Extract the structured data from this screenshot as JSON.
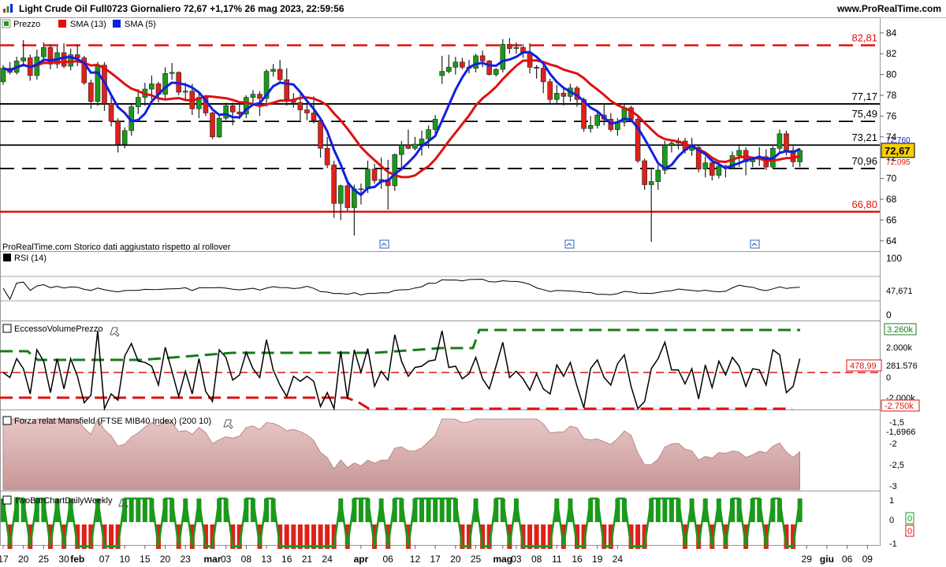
{
  "header": {
    "title": "Light Crude Oil Full0723 Giornaliero 72,67 +1,17% 26 mag 2023, 22:59:56",
    "site": "www.ProRealTime.com"
  },
  "colors": {
    "up": "#1a9a1a",
    "down": "#e0201a",
    "sma13": "#e01010",
    "sma5": "#1020e0",
    "green_dash": "#1a7a1a",
    "mansfield_fill": "#d9b3b3"
  },
  "price_panel": {
    "labels": [
      "Prezzo",
      "SMA (13)",
      "SMA (5)"
    ],
    "note": "ProRealTime.com  Storico dati aggiustato rispetto al rollover",
    "y_ticks": [
      "84",
      "82",
      "80",
      "78",
      "76",
      "74",
      "72",
      "70",
      "68",
      "66",
      "64"
    ],
    "levels": [
      {
        "value": 82.81,
        "label": "82,81",
        "style": "red-dash"
      },
      {
        "value": 77.17,
        "label": "77,17",
        "style": "black-solid"
      },
      {
        "value": 75.49,
        "label": "75,49",
        "style": "black-dash"
      },
      {
        "value": 73.21,
        "label": "73,21",
        "style": "black-solid"
      },
      {
        "value": 70.96,
        "label": "70,96",
        "style": "black-dash"
      },
      {
        "value": 66.8,
        "label": "66,80",
        "style": "red-solid"
      }
    ],
    "last_price": "72,67",
    "sma5_value": "72,760",
    "sma13_value": "72,095"
  },
  "rsi_panel": {
    "label": "RSI (14)",
    "y_ticks": [
      "100",
      "0"
    ],
    "value": "47,671"
  },
  "evp_panel": {
    "label": "EccessoVolumePrezzo",
    "y_ticks": [
      "2.000k",
      "0",
      "-2.000k"
    ],
    "upper": "3.260k",
    "lower": "-2.750k",
    "red_level": "478,99",
    "value": "281.576"
  },
  "mansfield_panel": {
    "label": "Forza relat Mansfield (FTSE MIB40 Index) (200 10)",
    "y_ticks": [
      "-1,5",
      "-2",
      "-2,5",
      "-3"
    ],
    "value": "-1,6966"
  },
  "tbc_panel": {
    "label": "TwoBarChartDailyWeekly",
    "y_ticks": [
      "1",
      "0",
      "-1"
    ],
    "value_top": "0",
    "value_bottom": "0"
  },
  "x_axis": {
    "labels": [
      "17",
      "20",
      "25",
      "30",
      "feb",
      "07",
      "10",
      "15",
      "20",
      "23",
      "mar",
      "03",
      "08",
      "13",
      "16",
      "21",
      "24",
      "apr",
      "06",
      "12",
      "17",
      "20",
      "25",
      "mag",
      "03",
      "08",
      "11",
      "16",
      "19",
      "24",
      "29",
      "giu",
      "06",
      "09"
    ]
  },
  "chart_data": {
    "type": "candlestick",
    "title": "Light Crude Oil Full0723 Giornaliero",
    "x_start": "2023-01-17",
    "x_end": "2023-05-26",
    "ylim": [
      63,
      85.5
    ],
    "ohlc": [
      [
        79.3,
        80.9,
        79.0,
        80.6
      ],
      [
        80.6,
        81.2,
        80.0,
        80.2
      ],
      [
        80.2,
        81.7,
        80.0,
        81.3
      ],
      [
        81.3,
        83.3,
        81.0,
        81.6
      ],
      [
        81.6,
        81.9,
        79.4,
        79.9
      ],
      [
        79.9,
        82.4,
        79.5,
        81.7
      ],
      [
        81.7,
        83.1,
        81.0,
        82.6
      ],
      [
        82.6,
        82.9,
        80.5,
        81.0
      ],
      [
        81.0,
        82.7,
        80.6,
        82.1
      ],
      [
        82.1,
        83.0,
        80.6,
        80.8
      ],
      [
        80.8,
        82.5,
        80.4,
        81.9
      ],
      [
        81.9,
        82.9,
        80.8,
        81.6
      ],
      [
        81.6,
        81.8,
        79.0,
        79.2
      ],
      [
        79.2,
        79.5,
        76.7,
        77.4
      ],
      [
        77.4,
        81.2,
        77.0,
        80.9
      ],
      [
        80.9,
        81.2,
        76.5,
        77.2
      ],
      [
        77.2,
        77.9,
        75.0,
        75.5
      ],
      [
        75.5,
        75.8,
        72.5,
        73.3
      ],
      [
        73.3,
        74.9,
        72.9,
        74.6
      ],
      [
        74.6,
        77.1,
        74.1,
        76.9
      ],
      [
        76.9,
        78.6,
        76.2,
        77.8
      ],
      [
        77.8,
        79.2,
        77.0,
        78.6
      ],
      [
        78.6,
        79.9,
        77.6,
        79.1
      ],
      [
        79.1,
        79.3,
        77.3,
        78.1
      ],
      [
        78.1,
        80.7,
        77.7,
        80.1
      ],
      [
        80.1,
        81.1,
        79.5,
        80.2
      ],
      [
        80.2,
        80.3,
        78.0,
        78.3
      ],
      [
        78.3,
        79.2,
        77.6,
        78.4
      ],
      [
        78.4,
        79.1,
        76.1,
        76.7
      ],
      [
        76.7,
        78.2,
        75.8,
        77.8
      ],
      [
        77.8,
        78.0,
        76.0,
        76.3
      ],
      [
        76.3,
        76.4,
        73.8,
        74.0
      ],
      [
        74.0,
        76.2,
        73.9,
        75.8
      ],
      [
        75.8,
        77.3,
        75.6,
        77.0
      ],
      [
        77.0,
        77.3,
        75.1,
        76.4
      ],
      [
        76.4,
        77.1,
        75.7,
        76.2
      ],
      [
        76.2,
        78.0,
        75.8,
        77.8
      ],
      [
        77.8,
        78.5,
        77.1,
        78.1
      ],
      [
        78.1,
        78.4,
        76.0,
        77.7
      ],
      [
        77.7,
        80.5,
        76.9,
        80.3
      ],
      [
        80.3,
        81.0,
        79.8,
        80.5
      ],
      [
        80.5,
        81.4,
        79.3,
        79.5
      ],
      [
        79.5,
        80.6,
        77.0,
        77.6
      ],
      [
        77.6,
        78.2,
        76.8,
        77.3
      ],
      [
        77.3,
        78.1,
        75.6,
        76.6
      ],
      [
        76.6,
        77.5,
        75.6,
        76.3
      ],
      [
        76.3,
        77.9,
        75.3,
        75.6
      ],
      [
        75.6,
        75.9,
        72.0,
        72.9
      ],
      [
        72.9,
        74.0,
        71.0,
        71.3
      ],
      [
        71.3,
        71.7,
        66.2,
        67.6
      ],
      [
        67.6,
        69.4,
        66.0,
        69.3
      ],
      [
        69.3,
        69.6,
        66.9,
        67.2
      ],
      [
        67.2,
        69.4,
        64.5,
        69.0
      ],
      [
        69.0,
        69.5,
        67.5,
        69.0
      ],
      [
        69.0,
        71.7,
        68.6,
        70.9
      ],
      [
        70.9,
        71.4,
        69.5,
        69.8
      ],
      [
        69.8,
        72.0,
        69.0,
        69.9
      ],
      [
        69.9,
        71.8,
        67.0,
        69.3
      ],
      [
        69.3,
        72.4,
        68.8,
        72.3
      ],
      [
        72.3,
        73.6,
        71.0,
        73.2
      ],
      [
        73.2,
        74.7,
        72.8,
        72.9
      ],
      [
        72.9,
        74.0,
        72.7,
        73.3
      ],
      [
        73.3,
        74.6,
        72.2,
        73.8
      ],
      [
        73.8,
        75.1,
        72.9,
        74.7
      ],
      [
        74.7,
        76.1,
        74.0,
        75.7
      ],
      [
        79.9,
        81.8,
        79.1,
        80.3
      ],
      [
        80.3,
        81.9,
        80.1,
        80.7
      ],
      [
        80.7,
        81.7,
        80.0,
        81.2
      ],
      [
        81.2,
        81.6,
        80.5,
        80.7
      ],
      [
        80.7,
        81.4,
        80.1,
        80.6
      ],
      [
        80.6,
        82.0,
        80.2,
        81.8
      ],
      [
        81.8,
        82.3,
        80.7,
        81.3
      ],
      [
        81.3,
        81.4,
        79.9,
        80.0
      ],
      [
        80.0,
        80.6,
        79.8,
        80.5
      ],
      [
        80.5,
        83.4,
        80.2,
        82.9
      ],
      [
        82.9,
        83.5,
        82.0,
        82.5
      ],
      [
        82.5,
        83.1,
        82.0,
        82.6
      ],
      [
        82.6,
        82.9,
        81.6,
        82.1
      ],
      [
        82.1,
        83.0,
        80.1,
        80.7
      ],
      [
        80.7,
        80.9,
        79.6,
        80.6
      ],
      [
        80.6,
        81.0,
        78.2,
        79.3
      ],
      [
        79.3,
        79.6,
        77.2,
        77.6
      ],
      [
        77.6,
        79.0,
        77.1,
        78.2
      ],
      [
        78.2,
        78.6,
        77.0,
        77.9
      ],
      [
        77.9,
        79.1,
        77.4,
        78.7
      ],
      [
        78.7,
        78.9,
        76.9,
        77.6
      ],
      [
        77.6,
        77.8,
        74.5,
        74.8
      ],
      [
        74.8,
        76.0,
        74.4,
        75.1
      ],
      [
        75.1,
        76.5,
        74.8,
        76.1
      ],
      [
        76.1,
        77.2,
        75.1,
        75.7
      ],
      [
        75.7,
        76.3,
        74.5,
        74.7
      ],
      [
        74.7,
        75.8,
        74.1,
        75.4
      ],
      [
        75.4,
        77.1,
        75.0,
        76.8
      ],
      [
        76.8,
        77.0,
        75.4,
        75.7
      ],
      [
        75.7,
        76.0,
        71.5,
        71.7
      ],
      [
        71.7,
        71.9,
        68.9,
        69.4
      ],
      [
        69.4,
        70.9,
        63.9,
        69.7
      ],
      [
        69.7,
        71.3,
        68.9,
        70.8
      ],
      [
        70.8,
        73.6,
        70.4,
        73.2
      ],
      [
        73.2,
        73.7,
        72.5,
        73.4
      ],
      [
        73.4,
        73.9,
        72.8,
        73.6
      ],
      [
        73.6,
        73.9,
        72.4,
        72.7
      ],
      [
        72.7,
        73.9,
        72.2,
        73.0
      ],
      [
        73.0,
        73.2,
        70.6,
        70.9
      ],
      [
        70.9,
        72.1,
        70.1,
        71.5
      ],
      [
        71.5,
        71.9,
        69.8,
        70.3
      ],
      [
        70.3,
        71.7,
        70.0,
        71.2
      ],
      [
        71.2,
        71.3,
        70.1,
        71.0
      ],
      [
        71.0,
        72.6,
        70.9,
        72.2
      ],
      [
        72.2,
        73.3,
        71.1,
        72.7
      ],
      [
        72.7,
        73.0,
        70.3,
        71.6
      ],
      [
        71.6,
        72.0,
        71.1,
        71.9
      ],
      [
        71.9,
        73.0,
        71.2,
        72.1
      ],
      [
        72.1,
        72.8,
        70.8,
        71.1
      ],
      [
        71.1,
        73.1,
        71.0,
        72.9
      ],
      [
        72.9,
        74.7,
        72.4,
        74.3
      ],
      [
        74.3,
        74.6,
        72.2,
        72.7
      ],
      [
        72.7,
        73.1,
        71.1,
        71.6
      ],
      [
        71.6,
        72.9,
        71.1,
        72.7
      ]
    ],
    "levels": [
      82.81,
      77.17,
      75.49,
      73.21,
      70.96,
      66.8
    ]
  }
}
